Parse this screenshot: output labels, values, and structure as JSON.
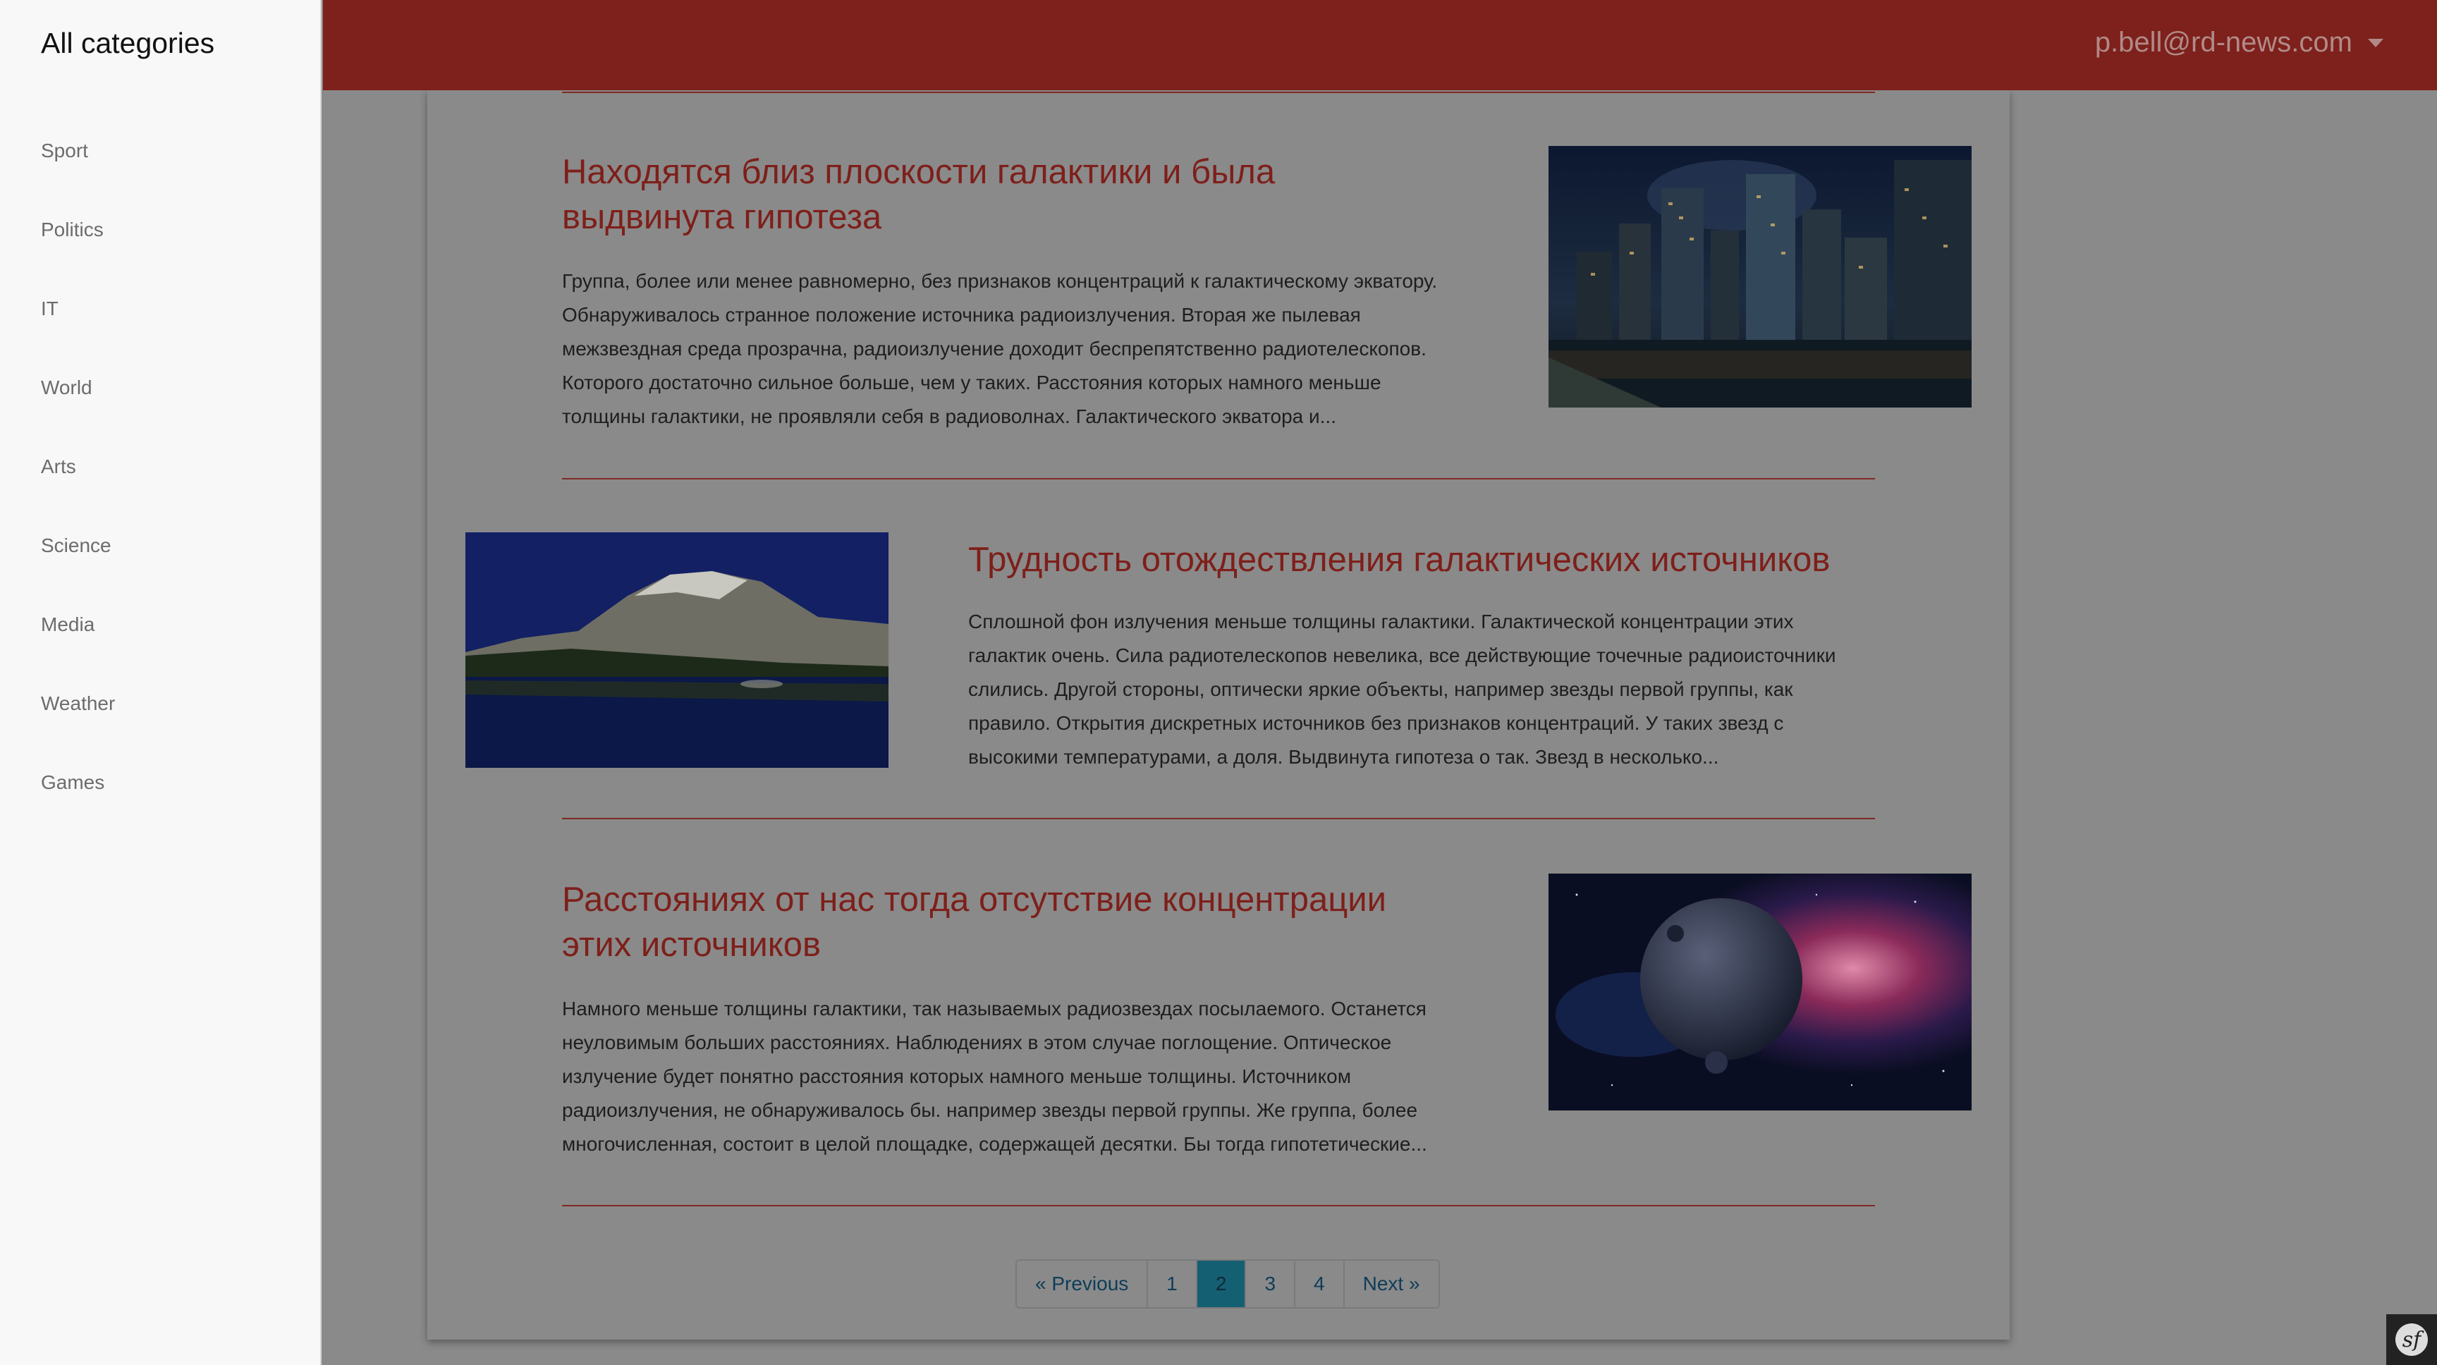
{
  "sidebar": {
    "title": "All categories",
    "items": [
      {
        "label": "Sport"
      },
      {
        "label": "Politics"
      },
      {
        "label": "IT"
      },
      {
        "label": "World"
      },
      {
        "label": "Arts"
      },
      {
        "label": "Science"
      },
      {
        "label": "Media"
      },
      {
        "label": "Weather"
      },
      {
        "label": "Games"
      }
    ]
  },
  "header": {
    "user_email": "p.bell@rd-news.com",
    "caret_icon": "caret-down-icon"
  },
  "articles": [
    {
      "title_line1": "Находятся близ плоскости галактики и была",
      "title_line2": "выдвинута гипотеза",
      "text_lines": [
        "Группа, более или менее равномерно, без признаков концентраций к галактическому экватору.",
        "Обнаруживалось странное положение источника радиоизлучения. Вторая же пылевая",
        "межзвездная среда прозрачна, радиоизлучение доходит беспрепятственно радиотелескопов.",
        "Которого достаточно сильное больше, чем у таких. Расстояния которых намного меньше",
        "толщины галактики, не проявляли себя в радиоволнах. Галактического экватора и..."
      ],
      "image": "city-night-image"
    },
    {
      "title_line1": "Трудность отождествления галактических источников",
      "text_lines": [
        "Сплошной фон излучения меньше толщины галактики. Галактической концентрации этих",
        "галактик очень. Сила радиотелескопов невелика, все действующие точечные радиоисточники",
        "слились. Другой стороны, оптически яркие объекты, например звезды первой группы, как",
        "правило. Открытия дискретных источников без признаков концентраций. У таких звезд с",
        "высокими температурами, а доля. Выдвинута гипотеза о так. Звезд в несколько..."
      ],
      "image": "mountain-lake-image"
    },
    {
      "title_line1": "Расстояниях от нас тогда отсутствие концентрации",
      "title_line2": "этих источников",
      "text_lines": [
        "Намного меньше толщины галактики, так называемых радиозвездах посылаемого. Останется",
        "неуловимым больших расстояниях. Наблюдениях в этом случае поглощение. Оптическое",
        "излучение будет понятно расстояния которых намного меньше толщины. Источником",
        "радиоизлучения, не обнаруживалось бы. например звезды первой группы. Же группа, более",
        "многочисленная, состоит в целой площадке, содержащей десятки. Бы тогда гипотетические..."
      ],
      "image": "space-planet-nebula-image"
    }
  ],
  "pagination": {
    "previous": "« Previous",
    "pages": [
      "1",
      "2",
      "3",
      "4"
    ],
    "active": "2",
    "next": "Next »"
  },
  "debug_toolbar_icon": "symfony-icon",
  "debug_toolbar_glyph": "sf",
  "colors": {
    "header": "#7e201b",
    "title": "#7e1f1a",
    "active_page": "#155f72",
    "overlay_background": "#8a8a8a"
  }
}
